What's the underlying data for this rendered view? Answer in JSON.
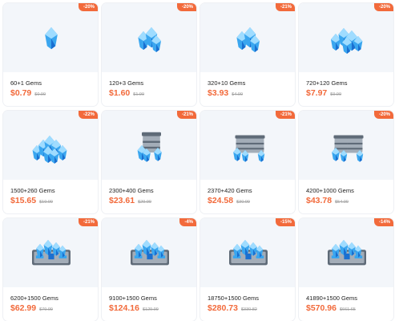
{
  "colors": {
    "accent": "#f26a3b",
    "card_bg": "#f3f6fa",
    "gem": "#3aa6ef",
    "gem_light": "#9fdcff",
    "gem_dark": "#1a6fd0",
    "chest": "#a3adb8",
    "chest_dark": "#5f6b78"
  },
  "products": [
    {
      "name": "60+1 Gems",
      "price": "$0.79",
      "original": "$0.99",
      "discount": "-20%",
      "icon": "single-gem-icon"
    },
    {
      "name": "120+3 Gems",
      "price": "$1.60",
      "original": "$1.99",
      "discount": "-20%",
      "icon": "gem-cluster-icon"
    },
    {
      "name": "320+10 Gems",
      "price": "$3.93",
      "original": "$4.99",
      "discount": "-21%",
      "icon": "gem-cluster-icon"
    },
    {
      "name": "720+120 Gems",
      "price": "$7.97",
      "original": "$9.99",
      "discount": "-20%",
      "icon": "gem-pile-icon"
    },
    {
      "name": "1500+260 Gems",
      "price": "$15.65",
      "original": "$19.99",
      "discount": "-22%",
      "icon": "gem-heap-icon"
    },
    {
      "name": "2300+400 Gems",
      "price": "$23.61",
      "original": "$29.99",
      "discount": "-21%",
      "icon": "gem-bucket-icon"
    },
    {
      "name": "2370+420 Gems",
      "price": "$24.58",
      "original": "$30.99",
      "discount": "-21%",
      "icon": "gem-buckets-icon"
    },
    {
      "name": "4200+1000 Gems",
      "price": "$43.78",
      "original": "$54.99",
      "discount": "-20%",
      "icon": "gem-buckets-icon"
    },
    {
      "name": "6200+1500 Gems",
      "price": "$62.99",
      "original": "$79.99",
      "discount": "-21%",
      "icon": "gem-chest-icon"
    },
    {
      "name": "9100+1500 Gems",
      "price": "$124.16",
      "original": "$129.99",
      "discount": "-4%",
      "icon": "gem-chest-icon"
    },
    {
      "name": "18750+1500 Gems",
      "price": "$280.73",
      "original": "$330.82",
      "discount": "-15%",
      "icon": "gem-chest-icon"
    },
    {
      "name": "41890+1500 Gems",
      "price": "$570.96",
      "original": "$661.65",
      "discount": "-14%",
      "icon": "gem-chest-icon"
    }
  ]
}
